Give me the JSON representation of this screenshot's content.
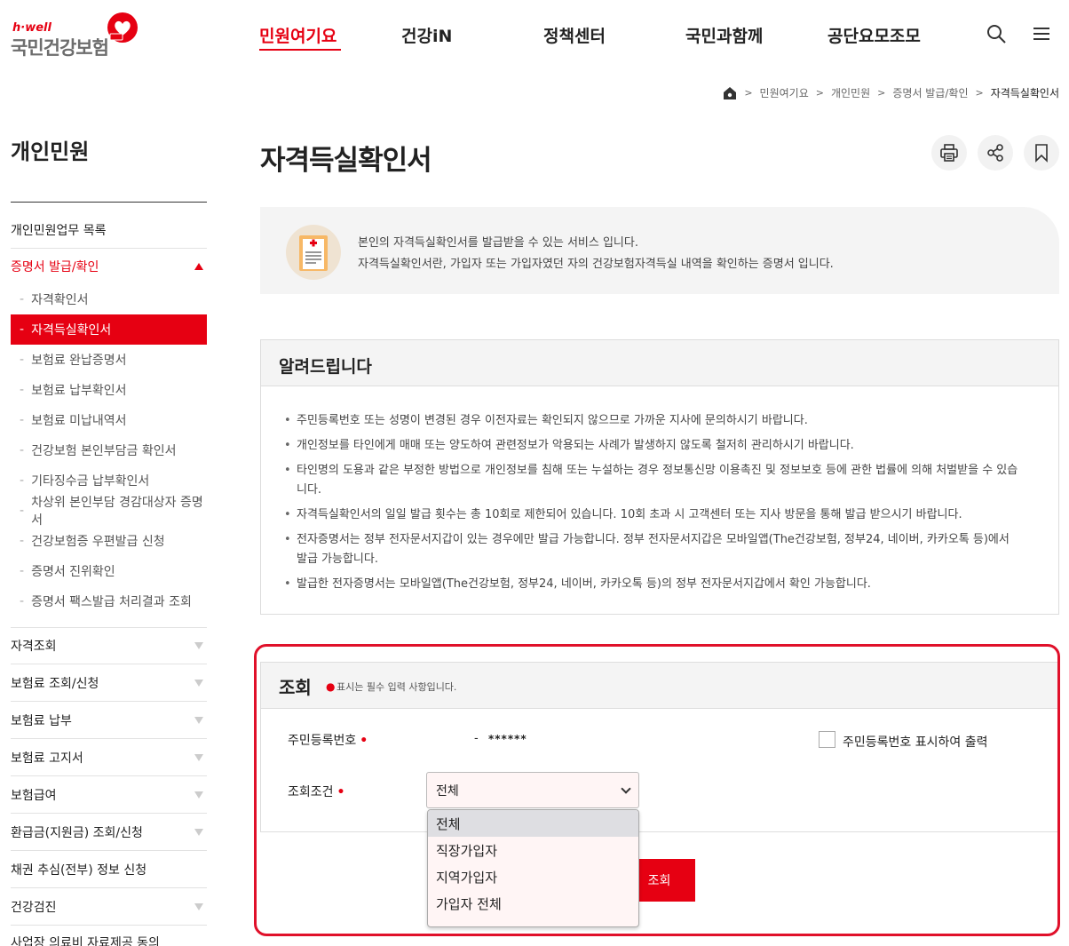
{
  "header": {
    "logo_tag": "h·well",
    "logo_name": "국민건강보험",
    "nav": [
      "민원여기요",
      "건강iN",
      "정책센터",
      "국민과함께",
      "공단요모조모"
    ],
    "active_nav": "민원여기요"
  },
  "breadcrumb": [
    "민원여기요",
    "개인민원",
    "증명서 발급/확인",
    "자격득실확인서"
  ],
  "sidebar": {
    "title": "개인민원",
    "items_before": [
      "개인민원업무 목록"
    ],
    "open_section": "증명서 발급/확인",
    "sub_items": [
      "자격확인서",
      "자격득실확인서",
      "보험료 완납증명서",
      "보험료 납부확인서",
      "보험료 미납내역서",
      "건강보험 본인부담금 확인서",
      "기타징수금 납부확인서",
      "차상위 본인부담 경감대상자 증명서",
      "건강보험증 우편발급 신청",
      "증명서 진위확인",
      "증명서 팩스발급 처리결과 조회"
    ],
    "active_sub": "자격득실확인서",
    "items_after": [
      "자격조회",
      "보험료 조회/신청",
      "보험료 납부",
      "보험료 고지서",
      "보험급여",
      "환급금(지원금) 조회/신청",
      "채권 추심(전부) 정보 신청",
      "건강검진",
      "사업장 의료비 자료제공 동의"
    ]
  },
  "page": {
    "title": "자격득실확인서",
    "intro_lines": [
      "본인의 자격득실확인서를 발급받을 수 있는 서비스 입니다.",
      "자격득실확인서란, 가입자 또는 가입자였던 자의 건강보험자격득실 내역을 확인하는 증명서 입니다."
    ]
  },
  "notice": {
    "title": "알려드립니다",
    "items": [
      "주민등록번호 또는 성명이 변경된 경우 이전자료는 확인되지 않으므로 가까운 지사에 문의하시기 바랍니다.",
      "개인정보를 타인에게 매매 또는 양도하여 관련정보가 악용되는 사례가 발생하지 않도록 철저히 관리하시기 바랍니다.",
      "타인명의 도용과 같은 부정한 방법으로 개인정보를 침해 또는 누설하는 경우 정보통신망 이용촉진 및 정보보호 등에 관한 법률에 의해 처벌받을 수 있습니다.",
      "자격득실확인서의 일일 발급 횟수는 총 10회로 제한되어 있습니다. 10회 초과 시 고객센터 또는 지사 방문을 통해 발급 받으시기 바랍니다.",
      "전자증명서는 정부 전자문서지갑이 있는 경우에만 발급 가능합니다. 정부 전자문서지갑은 모바일앱(The건강보험, 정부24, 네이버, 카카오톡 등)에서 발급 가능합니다.",
      "발급한 전자증명서는 모바일앱(The건강보험, 정부24, 네이버, 카카오톡 등)의 정부 전자문서지갑에서 확인 가능합니다."
    ]
  },
  "search": {
    "title": "조회",
    "required_note": "표시는 필수 입력 사항입니다.",
    "ssn_label": "주민등록번호",
    "ssn_dash": "-",
    "ssn_mask": "******",
    "ssn_check_label": "주민등록번호 표시하여 출력",
    "condition_label": "조회조건",
    "condition_value": "전체",
    "condition_options": [
      "전체",
      "직장가입자",
      "지역가입자",
      "가입자 전체"
    ],
    "button_label": "조회"
  },
  "colors": {
    "accent": "#e60012",
    "highlight_border": "#e0102a"
  }
}
